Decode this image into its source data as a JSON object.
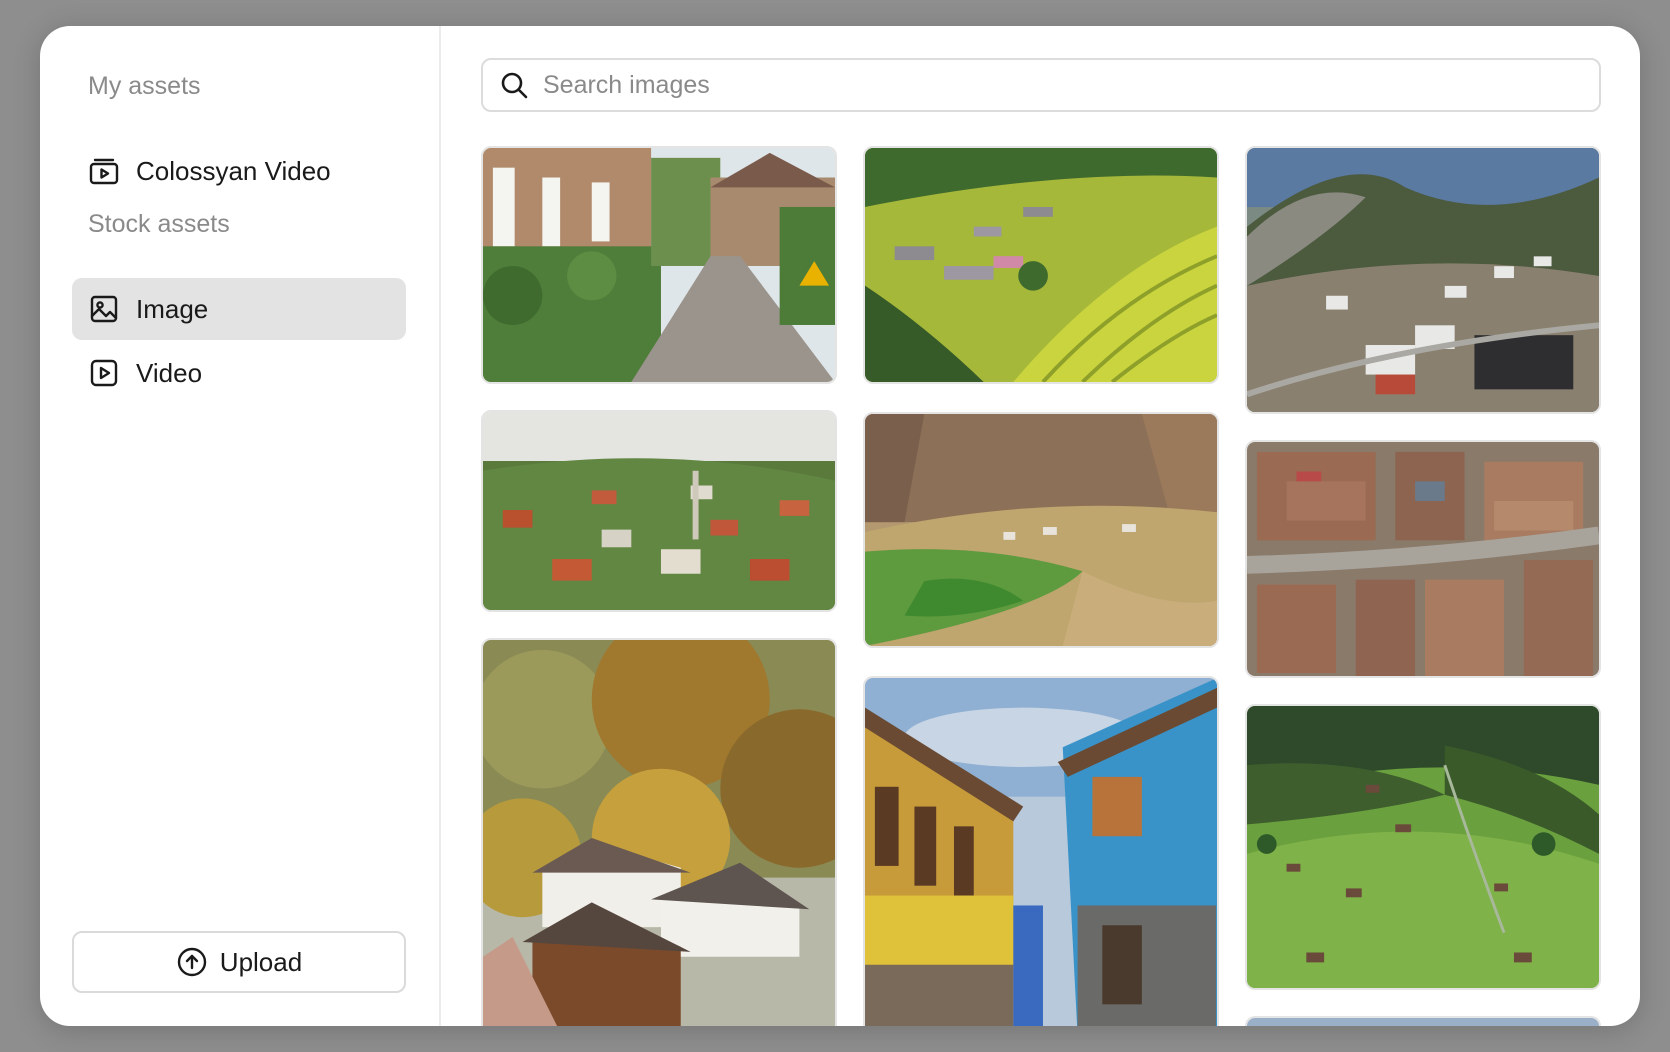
{
  "sidebar": {
    "my_assets_label": "My assets",
    "my_assets_items": [
      {
        "label": "Colossyan Video",
        "icon": "video-folder-icon"
      }
    ],
    "stock_assets_label": "Stock assets",
    "stock_items": [
      {
        "label": "Image",
        "icon": "image-icon",
        "active": true
      },
      {
        "label": "Video",
        "icon": "video-icon",
        "active": false
      }
    ],
    "upload_label": "Upload",
    "upload_icon": "upload-arrow-icon"
  },
  "search": {
    "placeholder": "Search images",
    "value": ""
  },
  "gallery": {
    "images": [
      "village-street-photo",
      "rice-terraces-photo",
      "mountain-village-aerial-photo",
      "hillside-town-photo",
      "canyon-valley-photo",
      "rooftops-aerial-photo",
      "autumn-alpine-village-photo",
      "blue-yellow-houses-photo",
      "green-alpine-meadow-photo",
      "partial-landscape-photo"
    ]
  },
  "colors": {
    "backdrop": "#8e8e8e",
    "panel": "#ffffff",
    "active_item": "#e3e3e3",
    "muted_text": "#8a8a8a",
    "text": "#1a1a1a",
    "border": "#dcdcdc"
  }
}
